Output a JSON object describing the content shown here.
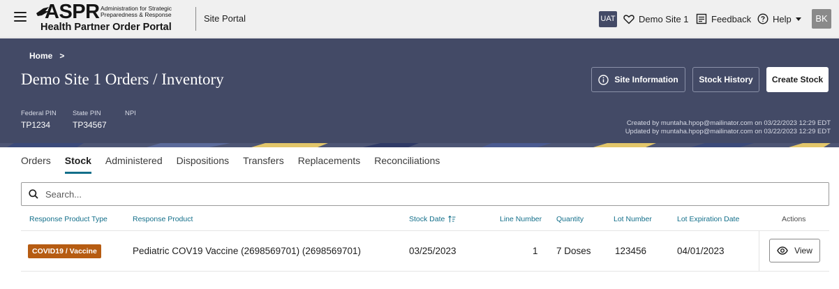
{
  "header": {
    "logo": {
      "acronym": "ASPR",
      "sub_lines": [
        "Administration for Strategic",
        "Preparedness & Response"
      ],
      "portal_name": "Health Partner Order Portal"
    },
    "section": "Site Portal",
    "env_badge": "UAT",
    "site_link": "Demo Site 1",
    "feedback_link": "Feedback",
    "help_link": "Help",
    "avatar": "BK"
  },
  "hero": {
    "breadcrumb_home": "Home",
    "breadcrumb_sep": ">",
    "title": "Demo Site 1 Orders / Inventory",
    "buttons": {
      "site_info": "Site Information",
      "stock_history": "Stock History",
      "create_stock": "Create Stock"
    },
    "pins": [
      {
        "label": "Federal PIN",
        "value": "TP1234"
      },
      {
        "label": "State PIN",
        "value": "TP34567"
      },
      {
        "label": "NPI",
        "value": ""
      }
    ],
    "created": "Created by muntaha.hpop@mailinator.com on 03/22/2023 12:29 EDT",
    "updated": "Updated by muntaha.hpop@mailinator.com on 03/22/2023 12:29 EDT"
  },
  "tabs": [
    "Orders",
    "Stock",
    "Administered",
    "Dispositions",
    "Transfers",
    "Replacements",
    "Reconciliations"
  ],
  "active_tab": "Stock",
  "search": {
    "placeholder": "Search..."
  },
  "table": {
    "columns": {
      "type": "Response Product Type",
      "product": "Response Product",
      "stock_date": "Stock Date",
      "line": "Line Number",
      "quantity": "Quantity",
      "lot": "Lot Number",
      "expiration": "Lot Expiration Date",
      "actions": "Actions"
    },
    "rows": [
      {
        "type": "COVID19 / Vaccine",
        "product": "Pediatric COV19 Vaccine (2698569701) (2698569701)",
        "stock_date": "03/25/2023",
        "line": "1",
        "quantity": "7 Doses",
        "lot": "123456",
        "expiration": "04/01/2023",
        "action": "View"
      }
    ]
  },
  "colors": {
    "header_bg": "#f0f0f0",
    "hero_bg": "#434a66",
    "accent_link": "#136f8a",
    "badge_bg": "#b65c12"
  }
}
